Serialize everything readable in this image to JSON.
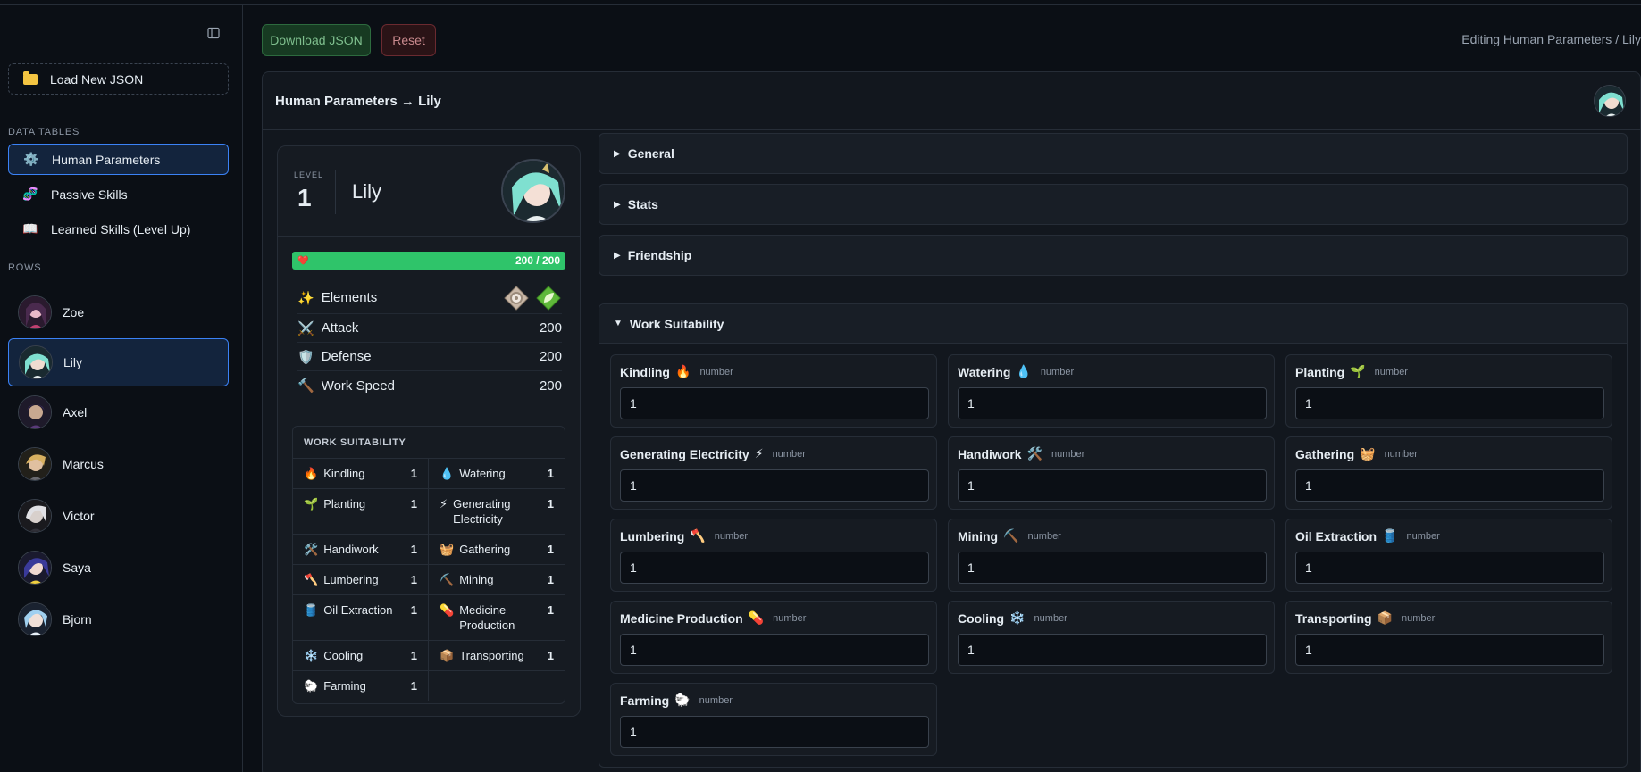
{
  "sidebar": {
    "load_label": "Load New JSON",
    "tables_header": "DATA TABLES",
    "tables": [
      {
        "label": "Human Parameters",
        "icon": "⚙️"
      },
      {
        "label": "Passive Skills",
        "icon": "🧬"
      },
      {
        "label": "Learned Skills (Level Up)",
        "icon": "📖"
      }
    ],
    "rows_header": "ROWS",
    "rows": [
      {
        "label": "Zoe"
      },
      {
        "label": "Lily"
      },
      {
        "label": "Axel"
      },
      {
        "label": "Marcus"
      },
      {
        "label": "Victor"
      },
      {
        "label": "Saya"
      },
      {
        "label": "Bjorn"
      }
    ]
  },
  "toolbar": {
    "download_label": "Download JSON",
    "reset_label": "Reset",
    "breadcrumb": "Editing Human Parameters / Lily"
  },
  "panel": {
    "title": "Human Parameters → Lily"
  },
  "card": {
    "level_label": "LEVEL",
    "level": "1",
    "name": "Lily",
    "hp_icon": "❤️",
    "hp_text": "200 / 200",
    "hp_fraction": 1.0,
    "elements_label": "Elements",
    "elements_icon": "✨",
    "stats": [
      {
        "label": "Attack",
        "icon": "⚔️",
        "value": "200"
      },
      {
        "label": "Defense",
        "icon": "🛡️",
        "value": "200"
      },
      {
        "label": "Work Speed",
        "icon": "🔨",
        "value": "200"
      }
    ],
    "ws_header": "WORK SUITABILITY",
    "ws": [
      {
        "label": "Kindling",
        "icon": "🔥",
        "value": "1"
      },
      {
        "label": "Watering",
        "icon": "💧",
        "value": "1"
      },
      {
        "label": "Planting",
        "icon": "🌱",
        "value": "1"
      },
      {
        "label": "Generating Electricity",
        "icon": "⚡",
        "value": "1"
      },
      {
        "label": "Handiwork",
        "icon": "🛠️",
        "value": "1"
      },
      {
        "label": "Gathering",
        "icon": "🧺",
        "value": "1"
      },
      {
        "label": "Lumbering",
        "icon": "🪓",
        "value": "1"
      },
      {
        "label": "Mining",
        "icon": "⛏️",
        "value": "1"
      },
      {
        "label": "Oil Extraction",
        "icon": "🛢️",
        "value": "1"
      },
      {
        "label": "Medicine Production",
        "icon": "💊",
        "value": "1"
      },
      {
        "label": "Cooling",
        "icon": "❄️",
        "value": "1"
      },
      {
        "label": "Transporting",
        "icon": "📦",
        "value": "1"
      },
      {
        "label": "Farming",
        "icon": "🐑",
        "value": "1"
      }
    ]
  },
  "sections": [
    {
      "label": "General",
      "expanded": false
    },
    {
      "label": "Stats",
      "expanded": false
    },
    {
      "label": "Friendship",
      "expanded": false
    },
    {
      "label": "Work Suitability",
      "expanded": true
    }
  ],
  "type_label": "number",
  "fields": [
    {
      "label": "Kindling",
      "icon": "🔥",
      "value": "1"
    },
    {
      "label": "Watering",
      "icon": "💧",
      "value": "1"
    },
    {
      "label": "Planting",
      "icon": "🌱",
      "value": "1"
    },
    {
      "label": "Generating Electricity",
      "icon": "⚡",
      "value": "1"
    },
    {
      "label": "Handiwork",
      "icon": "🛠️",
      "value": "1"
    },
    {
      "label": "Gathering",
      "icon": "🧺",
      "value": "1"
    },
    {
      "label": "Lumbering",
      "icon": "🪓",
      "value": "1"
    },
    {
      "label": "Mining",
      "icon": "⛏️",
      "value": "1"
    },
    {
      "label": "Oil Extraction",
      "icon": "🛢️",
      "value": "1"
    },
    {
      "label": "Medicine Production",
      "icon": "💊",
      "value": "1"
    },
    {
      "label": "Cooling",
      "icon": "❄️",
      "value": "1"
    },
    {
      "label": "Transporting",
      "icon": "📦",
      "value": "1"
    },
    {
      "label": "Farming",
      "icon": "🐑",
      "value": "1"
    }
  ],
  "colors": {
    "accent": "#3b82f6",
    "hp": "#2fc46a",
    "download": "#173a22",
    "reset": "#2a1316"
  }
}
